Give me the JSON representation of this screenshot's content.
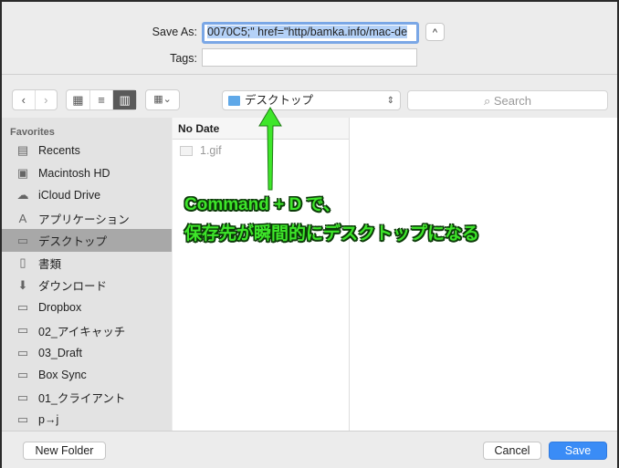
{
  "save_as": {
    "label": "Save As:",
    "value": "0070C5;\" href=\"http/bamka.info/mac-de"
  },
  "tags": {
    "label": "Tags:",
    "value": ""
  },
  "toolbar": {
    "back": "‹",
    "forward": "›",
    "view_icons": "▦",
    "view_list": "≡",
    "view_columns": "▥",
    "arrange": "▦⌄",
    "location": "デスクトップ",
    "search_placeholder": "Search"
  },
  "sidebar": {
    "heading": "Favorites",
    "items": [
      {
        "label": "Recents",
        "icon": "recents-icon",
        "glyph": "▤"
      },
      {
        "label": "Macintosh HD",
        "icon": "hard-drive-icon",
        "glyph": "▣"
      },
      {
        "label": "iCloud Drive",
        "icon": "cloud-icon",
        "glyph": "☁"
      },
      {
        "label": "アプリケーション",
        "icon": "applications-icon",
        "glyph": "A"
      },
      {
        "label": "デスクトップ",
        "icon": "desktop-icon",
        "glyph": "▭",
        "selected": true
      },
      {
        "label": "書類",
        "icon": "documents-icon",
        "glyph": "▯"
      },
      {
        "label": "ダウンロード",
        "icon": "downloads-icon",
        "glyph": "⬇"
      },
      {
        "label": "Dropbox",
        "icon": "folder-icon",
        "glyph": "▭"
      },
      {
        "label": "02_アイキャッチ",
        "icon": "folder-icon",
        "glyph": "▭"
      },
      {
        "label": "03_Draft",
        "icon": "folder-icon",
        "glyph": "▭"
      },
      {
        "label": "Box Sync",
        "icon": "folder-icon",
        "glyph": "▭"
      },
      {
        "label": "01_クライアント",
        "icon": "folder-icon",
        "glyph": "▭"
      },
      {
        "label": "p→j",
        "icon": "folder-icon",
        "glyph": "▭"
      }
    ]
  },
  "browser": {
    "column_header": "No Date",
    "files": [
      "1.gif"
    ]
  },
  "annotation": {
    "line1": "Command + D で、",
    "line2": "保存先が瞬間的にデスクトップになる",
    "color": "#3ee62a"
  },
  "buttons": {
    "new_folder": "New Folder",
    "cancel": "Cancel",
    "save": "Save"
  },
  "colors": {
    "accent": "#3a8cf6"
  }
}
